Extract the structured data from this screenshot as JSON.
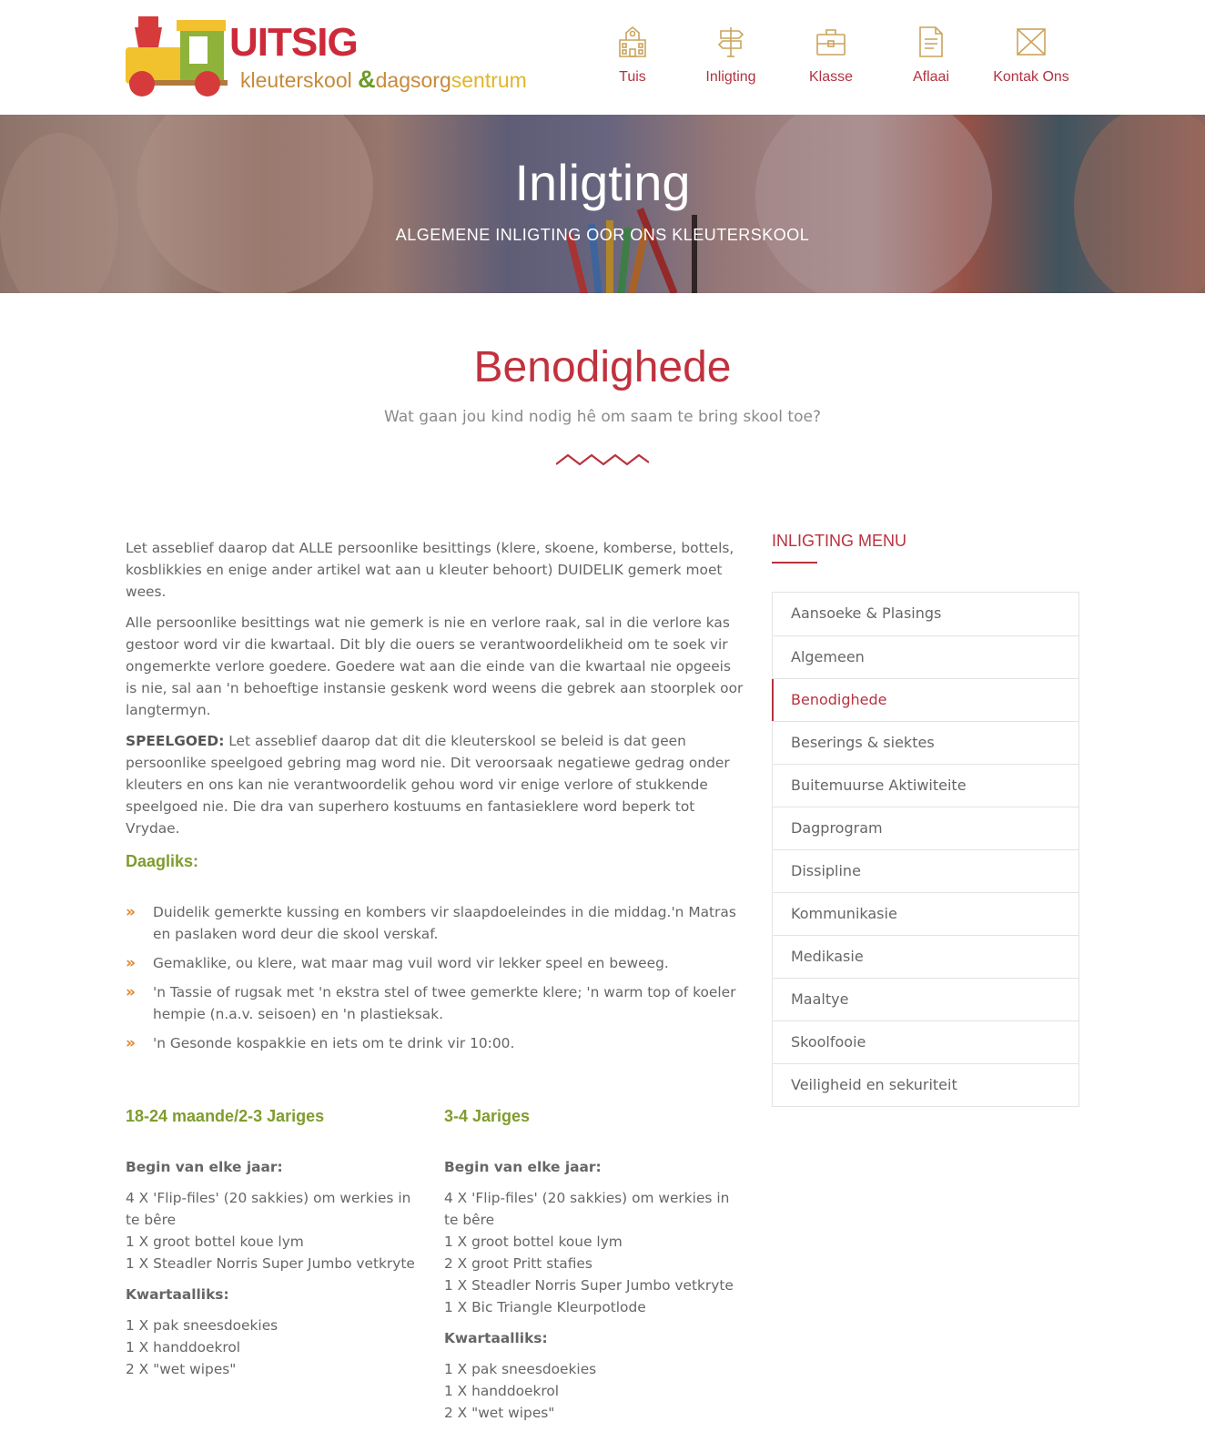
{
  "logo": {
    "word": "UITSIG",
    "sub_k": "kleuterskool ",
    "sub_amp": "&",
    "sub_d": "dagsorg",
    "sub_s": "sentrum"
  },
  "nav": [
    {
      "label": "Tuis",
      "icon": "school-icon"
    },
    {
      "label": "Inligting",
      "icon": "signpost-icon"
    },
    {
      "label": "Klasse",
      "icon": "briefcase-icon"
    },
    {
      "label": "Aflaai",
      "icon": "document-icon"
    },
    {
      "label": "Kontak Ons",
      "icon": "envelope-icon"
    }
  ],
  "colors": {
    "accent": "#c0323e",
    "green": "#7f9c2e",
    "bullet": "#e0862a",
    "nav_icon": "#c9a45c"
  },
  "hero": {
    "title": "Inligting",
    "subtitle": "ALGEMENE INLIGTING OOR ONS KLEUTERSKOOL"
  },
  "section": {
    "title": "Benodighede",
    "subtitle": "Wat gaan jou kind nodig hê om saam te bring skool toe?"
  },
  "body": {
    "p1": "Let asseblief daarop dat ALLE persoonlike besittings (klere, skoene, komberse, bottels, kosblikkies en enige ander artikel wat aan u kleuter behoort) DUIDELIK gemerk moet wees.",
    "p2": "Alle persoonlike besittings wat nie gemerk is nie en verlore raak, sal in die verlore kas gestoor word vir die kwartaal. Dit bly die ouers se verantwoordelikheid om te soek vir ongemerkte verlore goedere. Goedere wat aan die einde van die kwartaal nie opgeeis is nie, sal aan 'n behoeftige instansie geskenk word weens die gebrek aan stoorplek oor langtermyn.",
    "p3_bold": "SPEELGOED:",
    "p3": " Let asseblief daarop dat dit die kleuterskool se beleid is dat geen persoonlike speelgoed gebring mag word nie. Dit veroorsaak negatiewe gedrag onder kleuters en ons kan nie verantwoordelik gehou word vir enige verlore of stukkende speelgoed nie. Die dra van superhero kostuums en fantasieklere word beperk tot Vrydae."
  },
  "daily": {
    "heading": "Daagliks:",
    "marker": "»",
    "items": [
      "Duidelik gemerkte kussing en kombers vir slaapdoeleindes in die middag.'n Matras en paslaken word deur die skool verskaf.",
      "Gemaklike, ou klere, wat maar mag vuil word vir lekker speel en beweeg.",
      "'n Tassie of rugsak met 'n ekstra stel of twee gemerkte klere; 'n warm top of koeler hempie (n.a.v. seisoen) en 'n plastieksak.",
      "'n Gesonde kospakkie en iets om te drink vir 10:00."
    ]
  },
  "col1": {
    "heading": "18-24 maande/2-3 Jariges",
    "start_h": "Begin van elke jaar:",
    "start_items": [
      "4 X 'Flip-files' (20 sakkies) om werkies in te bêre",
      "1 X groot bottel koue lym",
      "1 X Steadler Norris Super Jumbo vetkryte"
    ],
    "q_h": "Kwartaalliks:",
    "q_items": [
      "1 X pak sneesdoekies",
      "1 X handdoekrol",
      "2 X \"wet wipes\""
    ]
  },
  "col2": {
    "heading": "3-4 Jariges",
    "start_h": "Begin van elke jaar:",
    "start_items": [
      "4 X 'Flip-files' (20 sakkies) om werkies in te bêre",
      "1 X groot bottel koue lym",
      "2 X groot Pritt stafies",
      "1 X Steadler Norris Super Jumbo vetkryte",
      "1 X Bic Triangle Kleurpotlode"
    ],
    "q_h": "Kwartaalliks:",
    "q_items": [
      "1 X pak sneesdoekies",
      "1 X handdoekrol",
      "2 X \"wet wipes\""
    ]
  },
  "sidebar": {
    "heading": "INLIGTING MENU",
    "active": "Benodighede",
    "items": [
      "Aansoeke & Plasings",
      "Algemeen",
      "Benodighede",
      "Beserings & siektes",
      "Buitemuurse Aktiwiteite",
      "Dagprogram",
      "Dissipline",
      "Kommunikasie",
      "Medikasie",
      "Maaltye",
      "Skoolfooie",
      "Veiligheid en sekuriteit"
    ]
  }
}
